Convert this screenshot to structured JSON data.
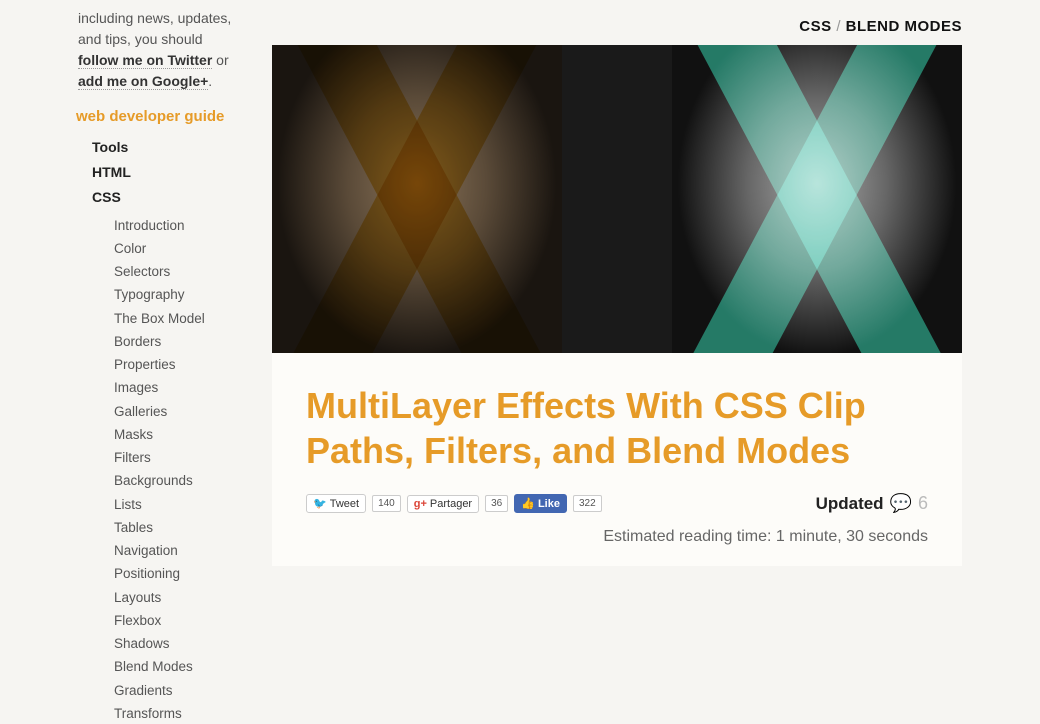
{
  "sidebar": {
    "intro_prefix": "including news, updates, and tips, you should ",
    "link_twitter": "follow me on Twitter",
    "intro_mid": " or ",
    "link_google": "add me on Google+",
    "intro_suffix": ".",
    "section_title": "web developer guide",
    "nav": {
      "item1": "Tools",
      "item2": "HTML",
      "item3": "CSS"
    },
    "css_topics": [
      "Introduction",
      "Color",
      "Selectors",
      "Typography",
      "The Box Model",
      "Borders",
      "Properties",
      "Images",
      "Galleries",
      "Masks",
      "Filters",
      "Backgrounds",
      "Lists",
      "Tables",
      "Navigation",
      "Positioning",
      "Layouts",
      "Flexbox",
      "Shadows",
      "Blend Modes",
      "Gradients",
      "Transforms"
    ]
  },
  "breadcrumb": {
    "a": "CSS",
    "sep": "/",
    "b": "BLEND MODES"
  },
  "article": {
    "title": "MultiLayer Effects With CSS Clip Paths, Filters, and Blend Modes",
    "social": {
      "tweet_label": "Tweet",
      "tweet_count": "140",
      "gplus_label": "Partager",
      "gplus_count": "36",
      "fb_label": "Like",
      "fb_count": "322"
    },
    "updated_label": "Updated",
    "comment_count": "6",
    "reading_time": "Estimated reading time: 1 minute, 30 seconds"
  }
}
